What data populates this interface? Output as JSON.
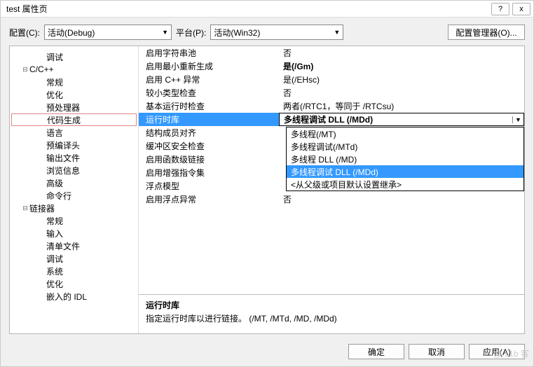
{
  "window": {
    "title": "test 属性页",
    "help": "?",
    "close": "x"
  },
  "toolbar": {
    "config_label": "配置(C):",
    "config_value": "活动(Debug)",
    "platform_label": "平台(P):",
    "platform_value": "活动(Win32)",
    "cfgmgr_label": "配置管理器(O)..."
  },
  "tree": {
    "items": [
      {
        "label": "调试",
        "indent": 2,
        "expander": ""
      },
      {
        "label": "C/C++",
        "indent": 1,
        "expander": "⊟"
      },
      {
        "label": "常规",
        "indent": 2,
        "expander": ""
      },
      {
        "label": "优化",
        "indent": 2,
        "expander": ""
      },
      {
        "label": "预处理器",
        "indent": 2,
        "expander": ""
      },
      {
        "label": "代码生成",
        "indent": 2,
        "expander": "",
        "selected": true
      },
      {
        "label": "语言",
        "indent": 2,
        "expander": ""
      },
      {
        "label": "预编译头",
        "indent": 2,
        "expander": ""
      },
      {
        "label": "输出文件",
        "indent": 2,
        "expander": ""
      },
      {
        "label": "浏览信息",
        "indent": 2,
        "expander": ""
      },
      {
        "label": "高级",
        "indent": 2,
        "expander": ""
      },
      {
        "label": "命令行",
        "indent": 2,
        "expander": ""
      },
      {
        "label": "链接器",
        "indent": 1,
        "expander": "⊟"
      },
      {
        "label": "常规",
        "indent": 2,
        "expander": ""
      },
      {
        "label": "输入",
        "indent": 2,
        "expander": ""
      },
      {
        "label": "清单文件",
        "indent": 2,
        "expander": ""
      },
      {
        "label": "调试",
        "indent": 2,
        "expander": ""
      },
      {
        "label": "系统",
        "indent": 2,
        "expander": ""
      },
      {
        "label": "优化",
        "indent": 2,
        "expander": ""
      },
      {
        "label": "嵌入的 IDL",
        "indent": 2,
        "expander": ""
      }
    ]
  },
  "props": {
    "rows": [
      {
        "k": "启用字符串池",
        "v": "否"
      },
      {
        "k": "启用最小重新生成",
        "v": "是(/Gm)",
        "bold": true
      },
      {
        "k": "启用 C++ 异常",
        "v": "是(/EHsc)"
      },
      {
        "k": "较小类型检查",
        "v": "否"
      },
      {
        "k": "基本运行时检查",
        "v": "两者(/RTC1，等同于 /RTCsu)"
      },
      {
        "k": "运行时库",
        "v": "多线程调试 DLL (/MDd)",
        "selected": true
      },
      {
        "k": "结构成员对齐",
        "v": ""
      },
      {
        "k": "缓冲区安全检查",
        "v": ""
      },
      {
        "k": "启用函数级链接",
        "v": ""
      },
      {
        "k": "启用增强指令集",
        "v": ""
      },
      {
        "k": "浮点模型",
        "v": ""
      },
      {
        "k": "启用浮点异常",
        "v": "否"
      }
    ],
    "dropdown": [
      {
        "label": "多线程(/MT)"
      },
      {
        "label": "多线程调试(/MTd)"
      },
      {
        "label": "多线程 DLL (/MD)"
      },
      {
        "label": "多线程调试 DLL (/MDd)",
        "hl": true
      },
      {
        "label": "<从父级或项目默认设置继承>"
      }
    ]
  },
  "desc": {
    "title": "运行时库",
    "body": "指定运行时库以进行链接。    (/MT, /MTd, /MD, /MDd)"
  },
  "buttons": {
    "ok": "确定",
    "cancel": "取消",
    "apply": "应用(A)"
  },
  "watermark": "@ 51b    客"
}
